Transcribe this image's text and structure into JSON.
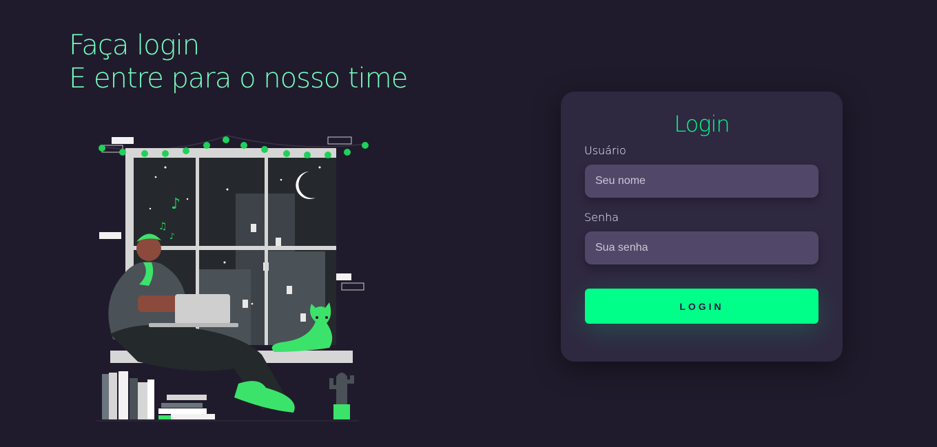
{
  "headline": {
    "line1": "Faça login",
    "line2": "E entre para o nosso time"
  },
  "illustration": {
    "subject": "person with laptop and cat at night window"
  },
  "login_card": {
    "title": "Login",
    "username_label": "Usuário",
    "username_placeholder": "Seu nome",
    "password_label": "Senha",
    "password_placeholder": "Sua senha",
    "button_label": "LOGIN"
  },
  "colors": {
    "background": "#201b2c",
    "accent": "#00ff88",
    "headline": "#77ffc0",
    "card": "#2f2841",
    "input": "#514869"
  }
}
